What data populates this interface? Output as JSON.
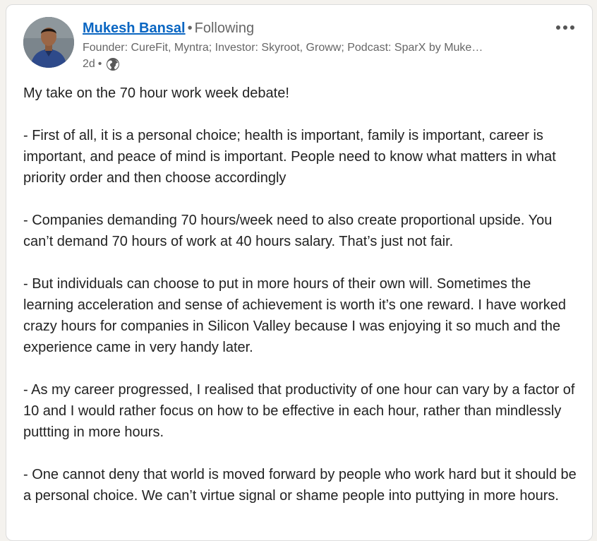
{
  "post": {
    "author": {
      "name": "Mukesh Bansal",
      "separator": "•",
      "follow_status": "Following",
      "headline": "Founder: CureFit, Myntra; Investor: Skyroot, Groww; Podcast: SparX by Muke…",
      "time": "2d",
      "time_separator": "•",
      "visibility_icon": "globe-icon"
    },
    "more_icon": "more-options-icon",
    "paragraphs": [
      "My take on the 70 hour work week debate!",
      "- First of all, it is a personal choice; health is important, family is important, career is important, and peace of mind is important. People need to know what matters in what priority order and then choose accordingly",
      "- Companies demanding 70 hours/week need to also create proportional upside. You can’t demand 70 hours of work at 40 hours salary. That’s just not fair.",
      "- But individuals can choose to put in more hours of their own will. Sometimes the learning acceleration and sense of achievement is worth it’s one reward. I have worked crazy hours for companies in Silicon Valley because I was enjoying it so much and the experience came in very handy later.",
      "- As my career progressed, I realised that productivity of one hour can vary by a factor of 10 and I would rather focus on how to be effective in each hour, rather than mindlessly puttting in more hours.",
      "- One cannot deny that world is moved forward by people who work hard but it should be a personal choice. We can’t virtue signal or shame people into puttying in more hours."
    ]
  },
  "colors": {
    "link": "#0a66c2",
    "secondary_text": "#666666",
    "body_text": "#222222"
  }
}
